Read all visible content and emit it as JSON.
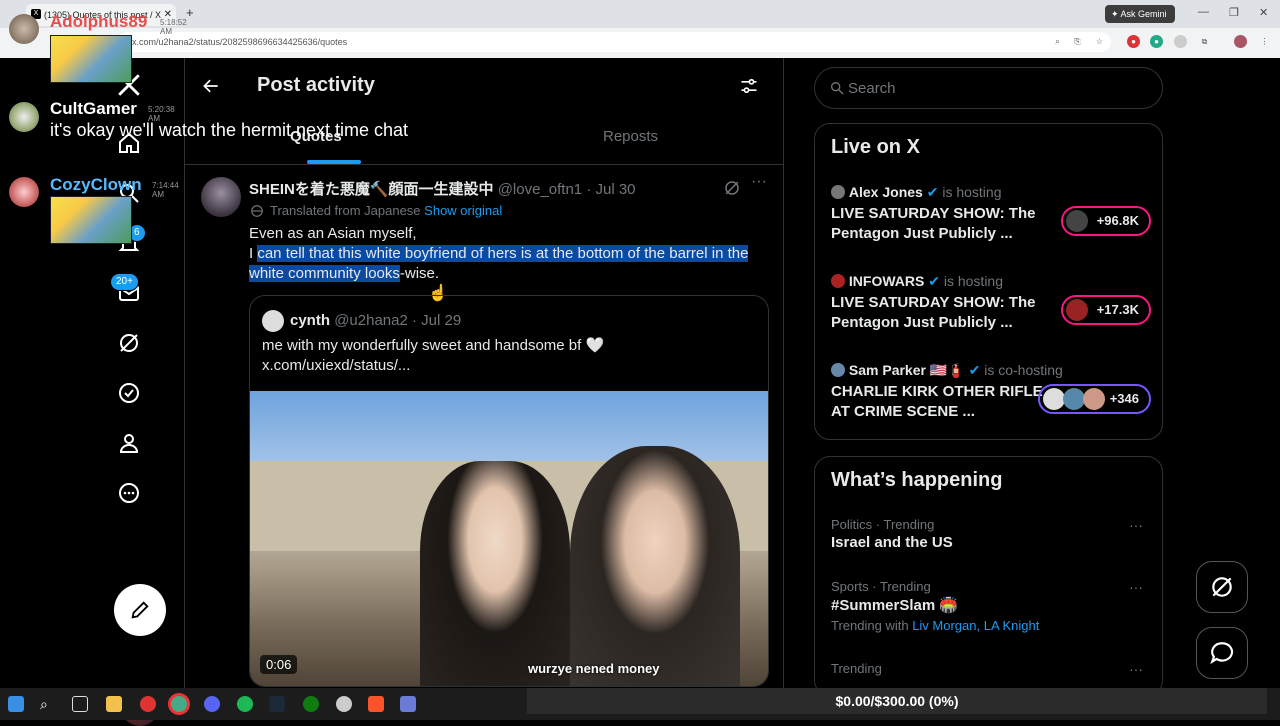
{
  "browser": {
    "tab_title": "(1305) Quotes of this post / X",
    "url": "x.com/u2hana2/status/2082598696634425636/quotes",
    "ask_gemini": "Ask Gemini"
  },
  "nav": {
    "badges": {
      "notifications": "6",
      "messages": "20+"
    }
  },
  "header": {
    "title": "Post activity",
    "tabs": [
      "Quotes",
      "Reposts"
    ]
  },
  "post": {
    "display_name": "SHEINを着た悪魔🔨顔面一生建設中",
    "handle_date": "@love_oftn1 · Jul 30",
    "translated_label": "Translated from Japanese",
    "show_original": "Show original",
    "line1": "Even as an Asian myself,",
    "line2_prefix": "I ",
    "line2_highlight": "can tell that this white boyfriend of hers is at the bottom of the barrel in the white community looks",
    "line2_suffix": "-wise.",
    "quote": {
      "display_name": "cynth",
      "handle_date": "@u2hana2 · Jul 29",
      "text_line1": "me with my wonderfully sweet and handsome bf 🤍",
      "text_line2": "x.com/uxiexd/status/...",
      "video_duration": "0:06",
      "video_caption": "wurzye nened money"
    }
  },
  "search": {
    "placeholder": "Search"
  },
  "live": {
    "title": "Live on X",
    "items": [
      {
        "host": "Alex Jones",
        "role": "is hosting",
        "title": "LIVE SATURDAY SHOW: The Pentagon Just Publicly ...",
        "count": "+96.8K"
      },
      {
        "host": "INFOWARS",
        "role": "is hosting",
        "title": "LIVE SATURDAY SHOW: The Pentagon Just Publicly ...",
        "count": "+17.3K"
      },
      {
        "host": "Sam Parker 🇺🇸🧯",
        "role": "is co-hosting",
        "title": "CHARLIE KIRK OTHER RIFLE AT CRIME SCENE ...",
        "count": "+346"
      }
    ]
  },
  "happening": {
    "title": "What’s happening",
    "items": [
      {
        "meta": "Politics · Trending",
        "name": "Israel and the US"
      },
      {
        "meta": "Sports · Trending",
        "name": "#SummerSlam 🏟️",
        "with_label": "Trending with",
        "with_links": "Liv Morgan, LA Knight"
      },
      {
        "meta": "Trending",
        "name": ""
      }
    ]
  },
  "chat": [
    {
      "user": "Adolphus89",
      "time": "5:18:52 AM",
      "message": ""
    },
    {
      "user": "CultGamer",
      "time": "5:20:38 AM",
      "message": "it's okay we'll watch the hermit next time chat"
    },
    {
      "user": "CozyClown",
      "time": "7:14:44 AM",
      "message": ""
    }
  ],
  "overlay": {
    "counter": "$0.00/$300.00 (0%)"
  },
  "colors": {
    "accent": "#1d9bf0",
    "live_pink": "#f91880",
    "live_purple": "#7856ff",
    "highlight": "#0b4aa0"
  }
}
